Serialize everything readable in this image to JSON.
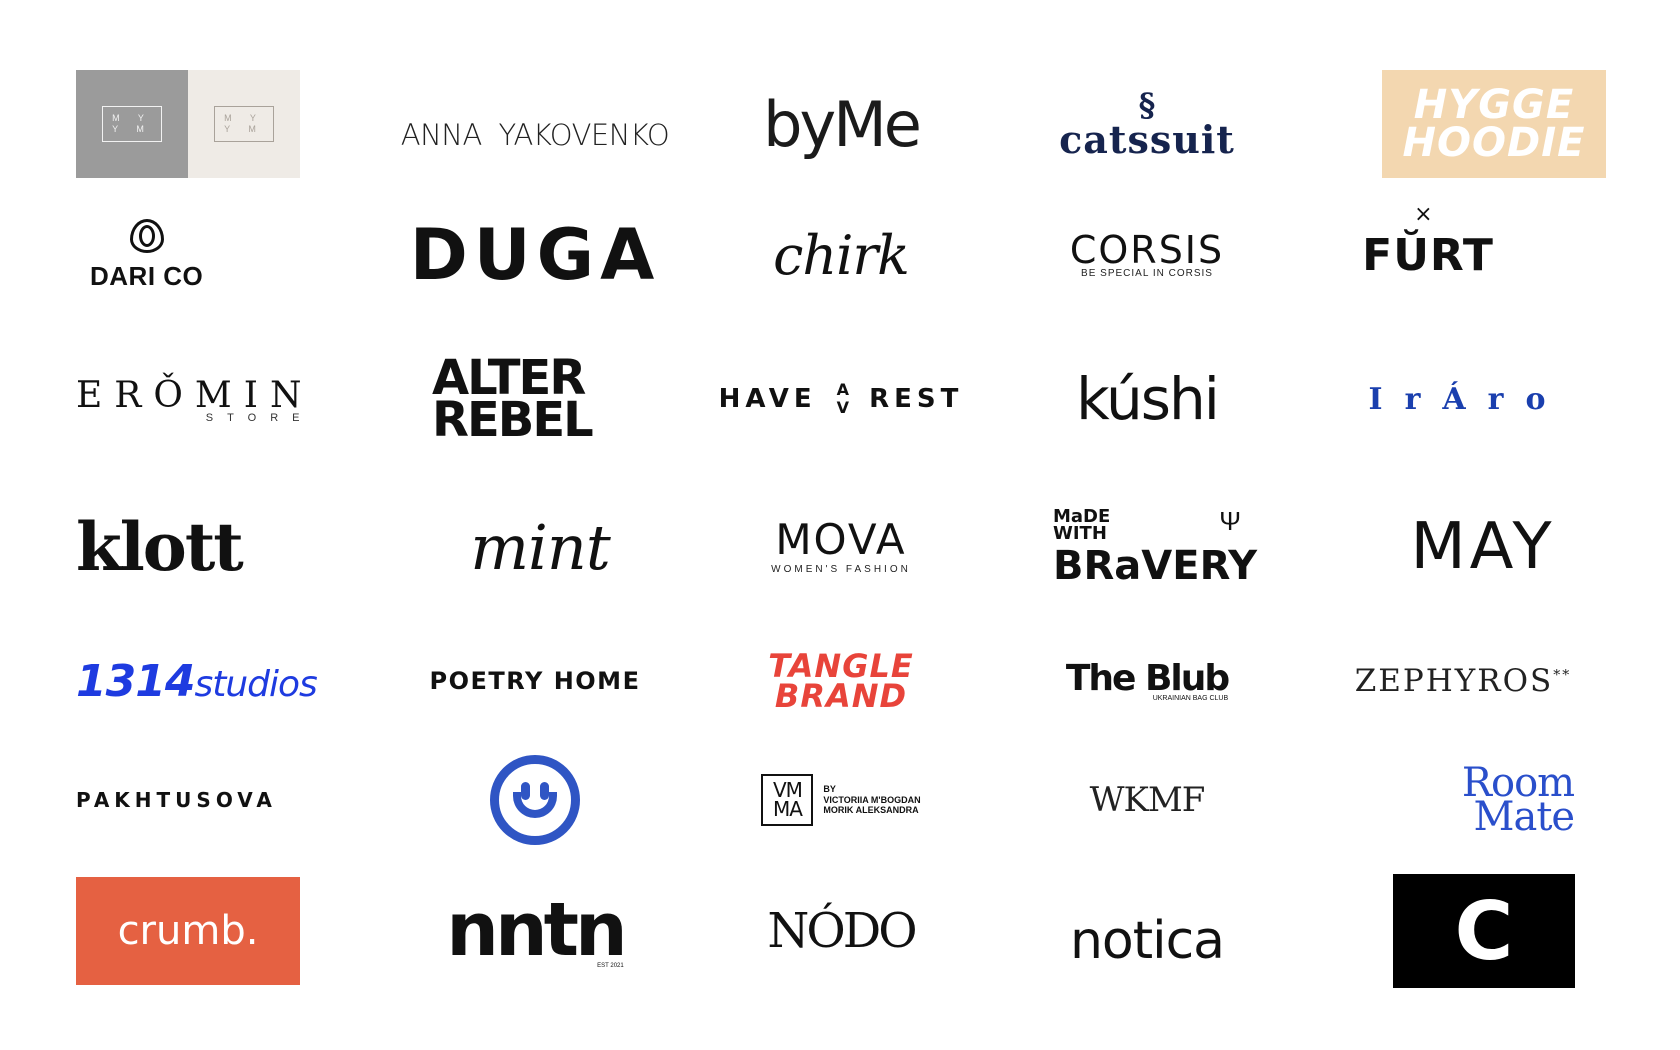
{
  "logos": {
    "mym": {
      "top": "M Y",
      "bottom": "Y M",
      "bg_dark": "#9b9b9b",
      "bg_light": "#efebe6"
    },
    "anna_yakovenko": "ANNA YAKOVENKO",
    "byme": "byMe",
    "catssuit": {
      "mark": "ꟹꟹ",
      "word": "catssuit",
      "color": "#16244e"
    },
    "hygge_hoodie": {
      "line1": "HYGGE",
      "line2": "HOODIE",
      "bg": "#f3d7b0"
    },
    "dari_co": "DARI CO",
    "duga": "DUGA",
    "chirk": "chirk",
    "corsis": {
      "word": "CORSIS",
      "tagline": "BE SPECIAL IN CORSIS"
    },
    "furt": {
      "word": "FŬRT",
      "mark": "×"
    },
    "eromin": {
      "word": "ERǑMIN",
      "sub": "STORE"
    },
    "alter_rebel": {
      "line1": "ALTER",
      "line2": "REBEL"
    },
    "have_a_rest": {
      "left": "HAVE",
      "up": "A",
      "down": "V",
      "right": "REST"
    },
    "kushi": "kúshi",
    "iraro": "IrÁro",
    "iraro_color": "#1a3fae",
    "klott": "klott",
    "mint": "mint",
    "mova": {
      "word": "MOVA",
      "tagline": "WOMEN'S FASHION"
    },
    "made_with_bravery": {
      "line1": "MaDE",
      "line2": "WITH",
      "big": "BRaVERY",
      "mark": "Ψ"
    },
    "may": "MAY",
    "studios_1314": {
      "num": "1314",
      "word": "studios",
      "color": "#1e3be0"
    },
    "poetry_home": "POETRY HOME",
    "tangle_brand": {
      "line1": "TANGLE",
      "line2": "BRAND",
      "color": "#e8443a"
    },
    "the_blub": {
      "word": "The Blub",
      "tagline": "UKRAINIAN BAG CLUB"
    },
    "zephyros": {
      "word": "ZEPHYROS",
      "stars": "**"
    },
    "pakhtusova": "PAKHTUSOVA",
    "smiley_color": "#2f55c4",
    "vmma": {
      "mono_top": "VM",
      "mono_bottom": "MA",
      "by": "BY",
      "name1": "VICTORIIA M'BOGDAN",
      "name2": "MORIK ALEKSANDRA"
    },
    "wkmf": "WKMF",
    "room_mate": {
      "line1": "Room",
      "line2": "Mate",
      "color": "#2a4fcb"
    },
    "crumb": {
      "word": "crumb.",
      "bg": "#e56142"
    },
    "nntn": {
      "word": "nntn",
      "tagline": "EST 2021"
    },
    "nodo": "NÓDO",
    "notica": "notica",
    "c_logo": "C"
  }
}
